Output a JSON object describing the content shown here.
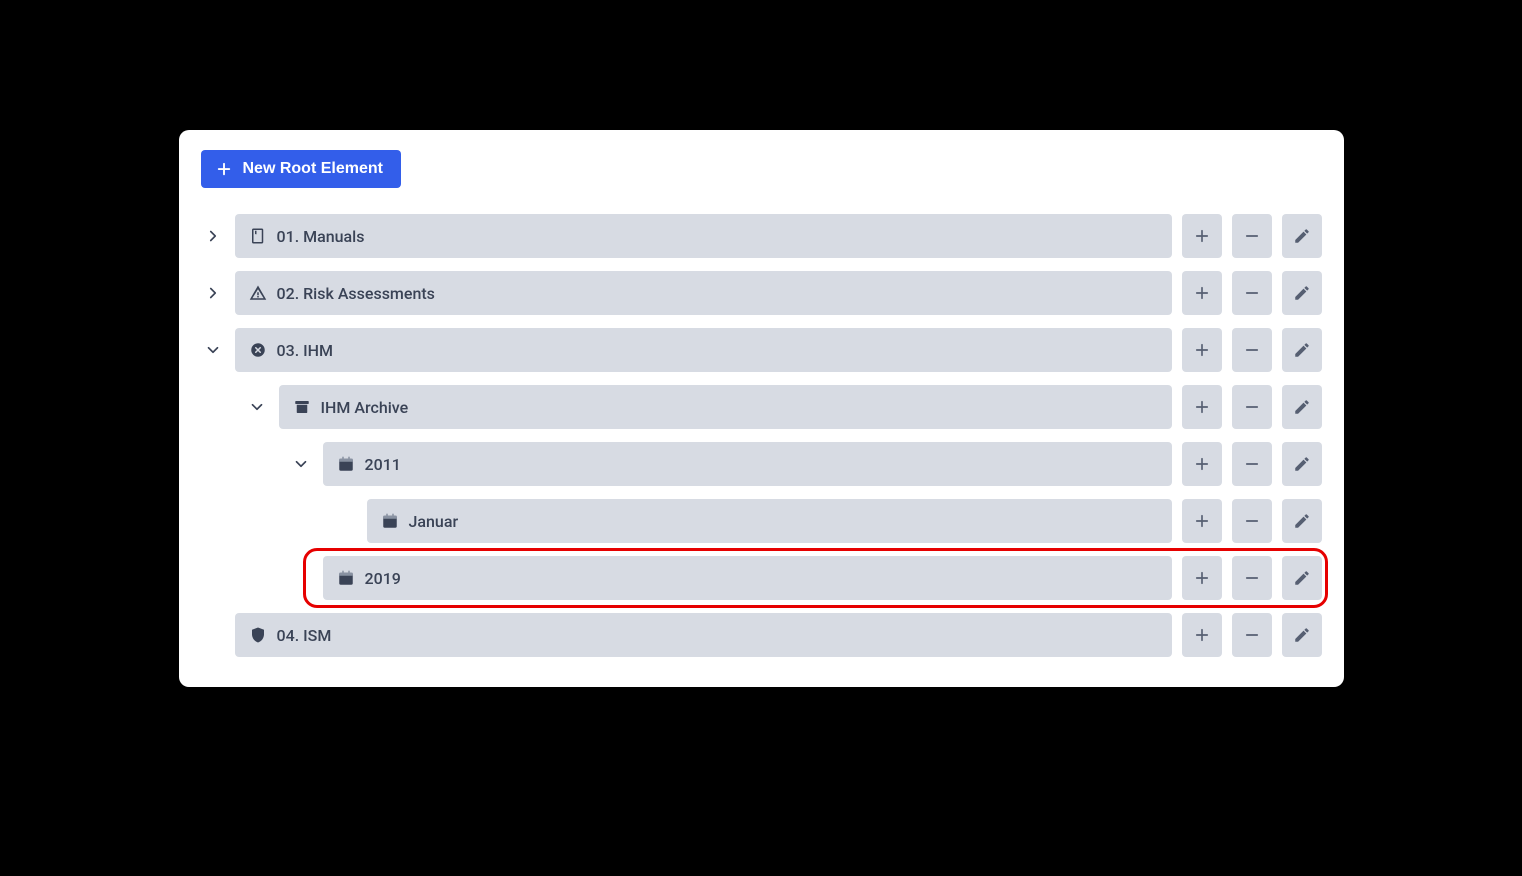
{
  "toolbar": {
    "new_root_label": "New Root Element"
  },
  "tree": [
    {
      "label": "01. Manuals",
      "icon": "book",
      "indent": 0,
      "expand": "right",
      "highlight": false
    },
    {
      "label": "02. Risk Assessments",
      "icon": "warning",
      "indent": 0,
      "expand": "right",
      "highlight": false
    },
    {
      "label": "03. IHM",
      "icon": "circle-x",
      "indent": 0,
      "expand": "down",
      "highlight": false
    },
    {
      "label": "IHM Archive",
      "icon": "archive",
      "indent": 1,
      "expand": "down",
      "highlight": false
    },
    {
      "label": "2011",
      "icon": "calendar",
      "indent": 2,
      "expand": "down",
      "highlight": false
    },
    {
      "label": "Januar",
      "icon": "calendar",
      "indent": 3,
      "expand": "none",
      "highlight": false
    },
    {
      "label": "2019",
      "icon": "calendar",
      "indent": 2,
      "expand": "none",
      "highlight": true
    },
    {
      "label": "04. ISM",
      "icon": "shield",
      "indent": 0,
      "expand": "none",
      "highlight": false
    }
  ]
}
